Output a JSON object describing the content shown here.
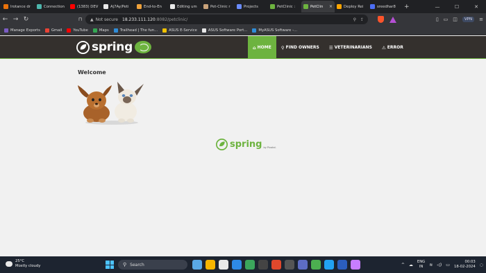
{
  "browser": {
    "tabs": [
      {
        "label": "Irotance dr",
        "color": "#e8710a"
      },
      {
        "label": "Connection",
        "color": "#4db6ac"
      },
      {
        "label": "(1383) DEV",
        "color": "#ff0000"
      },
      {
        "label": "Aj7Ay/Peti",
        "color": "#e8e8e8"
      },
      {
        "label": "End-to-En",
        "color": "#f0a23b"
      },
      {
        "label": "Editing um",
        "color": "#e8e8e8"
      },
      {
        "label": "Pet-Clinic r",
        "color": "#c9a27a"
      },
      {
        "label": "Projects",
        "color": "#6a8cff"
      },
      {
        "label": "PetClinic :",
        "color": "#6db33f"
      },
      {
        "label": "PetClin",
        "color": "#6db33f"
      },
      {
        "label": "Deploy Rei",
        "color": "#ffa500"
      },
      {
        "label": "sreedhar8",
        "color": "#4c6ef5"
      }
    ],
    "active_tab_index": 9,
    "url": {
      "security_label": "Not secure",
      "host": "18.233.111.120",
      "path": ":8082/petclinic/"
    },
    "vpn_label": "VPN",
    "bookmarks": [
      {
        "label": "Manage Exports",
        "color": "#7b5cc4"
      },
      {
        "label": "Gmail",
        "color": "#ea4335"
      },
      {
        "label": "YouTube",
        "color": "#ff0000"
      },
      {
        "label": "Maps",
        "color": "#34a853"
      },
      {
        "label": "Trailhead | The fun...",
        "color": "#2f8dd8"
      },
      {
        "label": "ASUS E-Service",
        "color": "#f2c200"
      },
      {
        "label": "ASUS Software Port...",
        "color": "#e8e8e8"
      },
      {
        "label": "MyASUS Software -...",
        "color": "#2f8dd8"
      }
    ]
  },
  "app": {
    "brand": "spring",
    "accent_color": "#6db33f",
    "nav": [
      {
        "label": "Home",
        "icon": "home-icon",
        "glyph": "⌂"
      },
      {
        "label": "Find owners",
        "icon": "search-icon",
        "glyph": "⚲"
      },
      {
        "label": "Veterinarians",
        "icon": "list-icon",
        "glyph": "☰"
      },
      {
        "label": "Error",
        "icon": "warning-icon",
        "glyph": "⚠"
      }
    ],
    "active_nav_index": 0,
    "heading": "Welcome",
    "footer_brand": "spring",
    "footer_by": "by Pivotal."
  },
  "taskbar": {
    "temperature": "25°C",
    "weather": "Mostly cloudy",
    "search_placeholder": "Search",
    "lang_line1": "ENG",
    "lang_line2": "IN",
    "time": "00:03",
    "date": "18-02-2024",
    "apps": [
      "#5aa9e6",
      "#f7b500",
      "#e9e9e9",
      "#2e8ae6",
      "#3ba55c",
      "#444",
      "#e0482c",
      "#555",
      "#5d6cc4",
      "#4caf50",
      "#22a2f2",
      "#2b5ebc",
      "#c77dff"
    ]
  }
}
